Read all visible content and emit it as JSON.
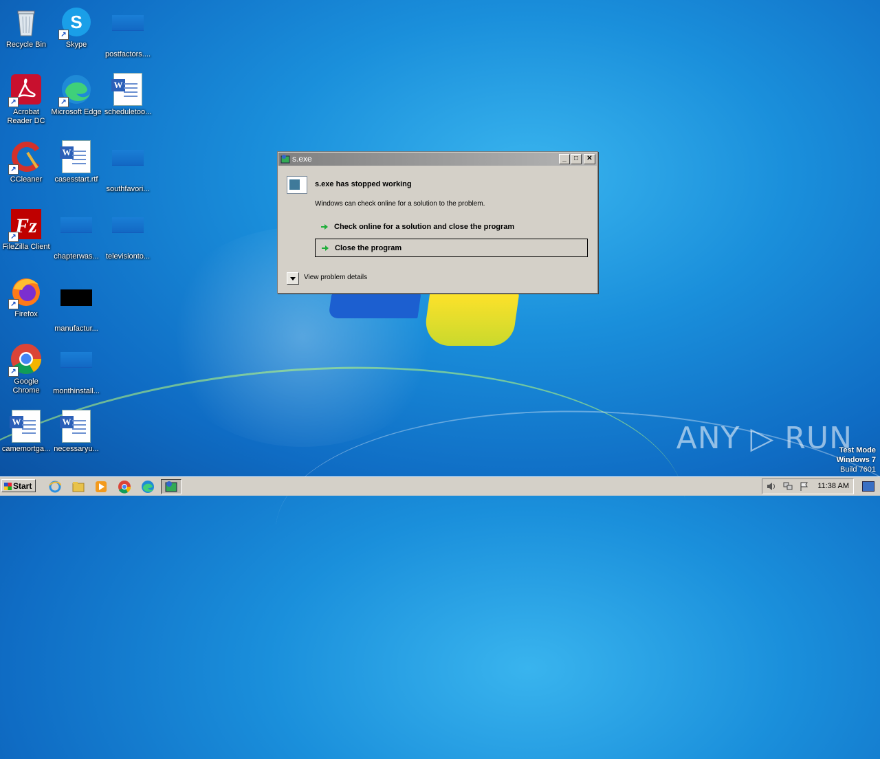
{
  "desktop": {
    "icons": [
      {
        "label": "Recycle Bin",
        "kind": "recycle-bin-icon"
      },
      {
        "label": "Skype",
        "kind": "skype-icon"
      },
      {
        "label": "postfactors....",
        "kind": "blank-file-icon"
      },
      {
        "label": "Acrobat Reader DC",
        "kind": "acrobat-icon"
      },
      {
        "label": "Microsoft Edge",
        "kind": "edge-icon"
      },
      {
        "label": "scheduletoo...",
        "kind": "word-doc-icon"
      },
      {
        "label": "CCleaner",
        "kind": "ccleaner-icon"
      },
      {
        "label": "casesstart.rtf",
        "kind": "word-doc-icon"
      },
      {
        "label": "southfavori...",
        "kind": "blank-file-icon"
      },
      {
        "label": "FileZilla Client",
        "kind": "filezilla-icon"
      },
      {
        "label": "chapterwas...",
        "kind": "blank-file-icon"
      },
      {
        "label": "televisionto...",
        "kind": "blank-file-icon"
      },
      {
        "label": "Firefox",
        "kind": "firefox-icon"
      },
      {
        "label": "manufactur...",
        "kind": "black-file-icon"
      },
      {
        "label": "Google Chrome",
        "kind": "chrome-icon"
      },
      {
        "label": "monthinstall...",
        "kind": "blank-file-icon"
      },
      {
        "label": "camemortga...",
        "kind": "word-doc-icon"
      },
      {
        "label": "necessaryu...",
        "kind": "word-doc-icon"
      }
    ]
  },
  "dialog": {
    "title": "s.exe",
    "heading": "s.exe has stopped working",
    "message": "Windows can check online for a solution to the problem.",
    "option_check_online": "Check online for a solution and close the program",
    "option_close": "Close the program",
    "details_label": "View problem details",
    "btn_minimize": "_",
    "btn_maximize": "□",
    "btn_close": "✕"
  },
  "taskbar": {
    "start_label": "Start",
    "clock": "11:38 AM",
    "apps": [
      "ie-icon",
      "explorer-icon",
      "media-player-icon",
      "chrome-icon",
      "edge-icon",
      "s-exe-icon"
    ]
  },
  "watermark": {
    "text": "ANY ▷ RUN",
    "line1": "Test Mode",
    "line2": "Windows 7",
    "line3": "Build 7601"
  },
  "colors": {
    "accent_green": "#1fae3a",
    "dialog_bg": "#d4d0c8"
  }
}
